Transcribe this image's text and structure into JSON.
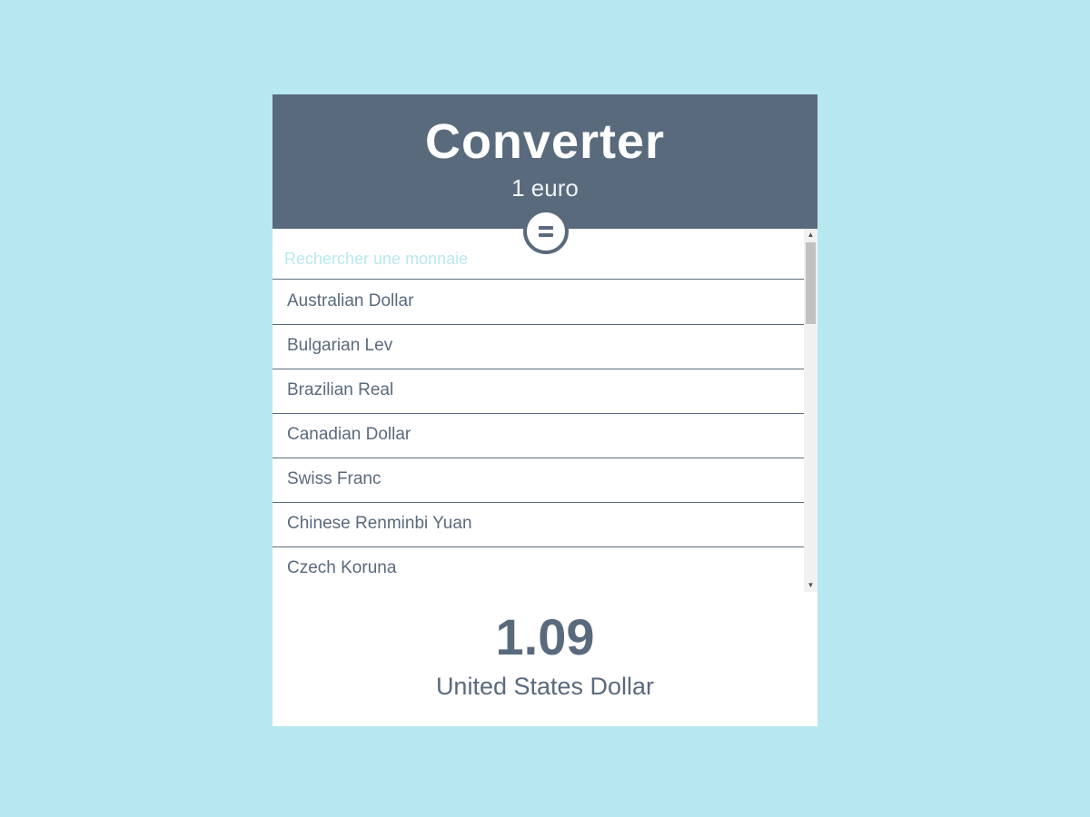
{
  "header": {
    "title": "Converter",
    "subtitle": "1 euro"
  },
  "swap_button": {
    "icon": "equals-icon",
    "label": "="
  },
  "search": {
    "placeholder": "Rechercher une monnaie",
    "value": ""
  },
  "currencies": [
    "Australian Dollar",
    "Bulgarian Lev",
    "Brazilian Real",
    "Canadian Dollar",
    "Swiss Franc",
    "Chinese Renminbi Yuan",
    "Czech Koruna"
  ],
  "result": {
    "value": "1.09",
    "currency": "United States Dollar"
  },
  "colors": {
    "background": "#b8e8ef",
    "header": "#5a6a7d",
    "text": "#5a6a7d",
    "card": "#ffffff"
  }
}
